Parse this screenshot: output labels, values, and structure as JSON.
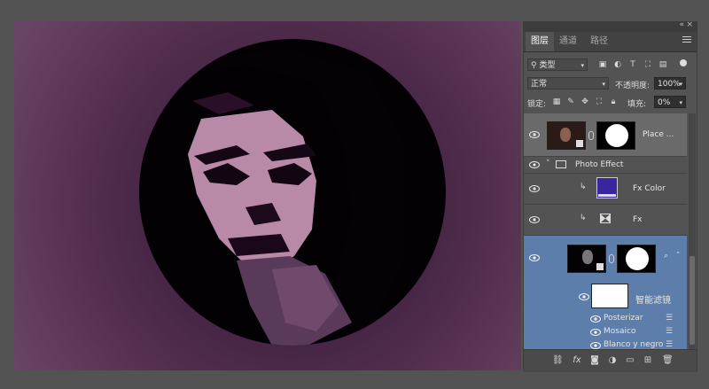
{
  "panel": {
    "tabs": [
      {
        "label": "图层",
        "active": true
      },
      {
        "label": "通道",
        "active": false
      },
      {
        "label": "路径",
        "active": false
      }
    ],
    "filter": {
      "value": "类型"
    },
    "blend": {
      "mode": "正常",
      "opacity_label": "不透明度:",
      "opacity_value": "100%"
    },
    "lock": {
      "label": "锁定:",
      "fill_label": "填充:",
      "fill_value": "0%"
    },
    "layers": {
      "place": {
        "name": "Place ..."
      },
      "photo_effect": {
        "name": "Photo Effect"
      },
      "fx_color": {
        "name": "Fx Color"
      },
      "fx": {
        "name": "Fx"
      },
      "smart_filters": {
        "name": "智能滤镜"
      },
      "filters": [
        "Posterizar",
        "Mosaico",
        "Blanco y negro"
      ]
    }
  },
  "colors": {
    "canvas_bg": "#5c3a59",
    "panel_bg": "#535353",
    "selected_layer": "#5d7daa",
    "fx_color_swatch": "#3a25a0",
    "face_light": "#b88aa8",
    "face_mid": "#5a3a5a"
  },
  "icons": [
    "eye-icon",
    "folder-icon",
    "chain-link-icon",
    "clip-arrow-icon",
    "lock-icon",
    "brush-icon",
    "move-icon",
    "link-icon",
    "fx-icon",
    "mask-icon",
    "adjustment-icon",
    "new-group-icon",
    "new-layer-icon",
    "trash-icon"
  ]
}
